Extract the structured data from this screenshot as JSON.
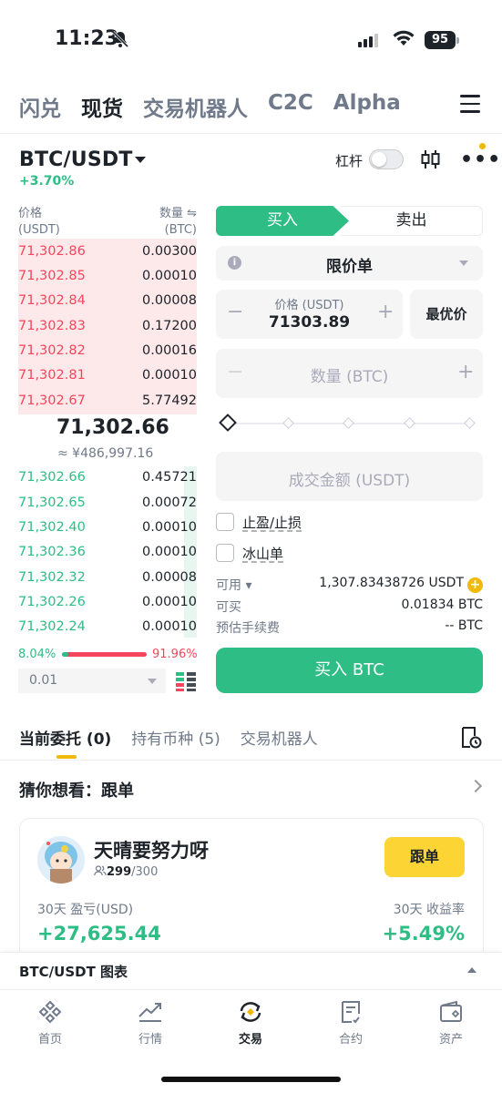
{
  "status_bar": {
    "time": "11:23",
    "battery": "95"
  },
  "top_tabs": [
    {
      "label": "闪兑",
      "active": false
    },
    {
      "label": "现货",
      "active": true
    },
    {
      "label": "交易机器人",
      "active": false
    },
    {
      "label": "C2C",
      "active": false
    },
    {
      "label": "Alpha",
      "active": false
    }
  ],
  "pair": {
    "symbol": "BTC/USDT",
    "change": "+3.70%",
    "leverage_label": "杠杆"
  },
  "orderbook": {
    "price_header": "价格",
    "price_unit": "(USDT)",
    "qty_header": "数量 ⇋",
    "qty_unit": "(BTC)",
    "asks": [
      {
        "price": "71,302.86",
        "qty": "0.00300"
      },
      {
        "price": "71,302.85",
        "qty": "0.00010"
      },
      {
        "price": "71,302.84",
        "qty": "0.00008"
      },
      {
        "price": "71,302.83",
        "qty": "0.17200"
      },
      {
        "price": "71,302.82",
        "qty": "0.00016"
      },
      {
        "price": "71,302.81",
        "qty": "0.00010"
      },
      {
        "price": "71,302.67",
        "qty": "5.77492"
      }
    ],
    "last_price": "71,302.66",
    "last_price_cny": "≈ ¥486,997.16",
    "bids": [
      {
        "price": "71,302.66",
        "qty": "0.45721"
      },
      {
        "price": "71,302.65",
        "qty": "0.00072"
      },
      {
        "price": "71,302.40",
        "qty": "0.00010"
      },
      {
        "price": "71,302.36",
        "qty": "0.00010"
      },
      {
        "price": "71,302.32",
        "qty": "0.00008"
      },
      {
        "price": "71,302.26",
        "qty": "0.00010"
      },
      {
        "price": "71,302.24",
        "qty": "0.00010"
      }
    ],
    "buy_ratio": "8.04%",
    "sell_ratio": "91.96%",
    "precision": "0.01"
  },
  "order_form": {
    "buy_tab": "买入",
    "sell_tab": "卖出",
    "order_type": "限价单",
    "price_label": "价格 (USDT)",
    "price_value": "71303.89",
    "best_price": "最优价",
    "qty_placeholder": "数量 (BTC)",
    "total_placeholder": "成交金额 (USDT)",
    "tp_sl": "止盈/止损",
    "iceberg": "冰山单",
    "available_label": "可用",
    "available_value": "1,307.83438726 USDT",
    "can_buy_label": "可买",
    "can_buy_value": "0.01834 BTC",
    "fee_label": "预估手续费",
    "fee_value": "-- BTC",
    "submit": "买入 BTC"
  },
  "order_tabs": [
    {
      "label": "当前委托 (0)",
      "active": true
    },
    {
      "label": "持有币种 (5)",
      "active": false
    },
    {
      "label": "交易机器人",
      "active": false
    }
  ],
  "copy_trade": {
    "title": "猜你想看：跟单",
    "trader_name": "天晴要努力呀",
    "followers": "299",
    "followers_max": "/300",
    "follow_button": "跟单",
    "pnl_label": "30天 盈亏(USD)",
    "pnl_value": "+27,625.44",
    "roi_label": "30天 收益率",
    "roi_value": "+5.49%"
  },
  "chart_bar": {
    "label": "BTC/USDT 图表"
  },
  "bottom_nav": [
    {
      "label": "首页",
      "icon": "binance-logo-icon"
    },
    {
      "label": "行情",
      "icon": "chart-trend-icon"
    },
    {
      "label": "交易",
      "icon": "exchange-icon",
      "active": true
    },
    {
      "label": "合约",
      "icon": "contract-document-icon"
    },
    {
      "label": "资产",
      "icon": "wallet-icon"
    }
  ],
  "colors": {
    "green": "#2ebd85",
    "red": "#f6465d",
    "yellow": "#f0b90b",
    "text": "#1e2329",
    "muted": "#707a8a"
  }
}
